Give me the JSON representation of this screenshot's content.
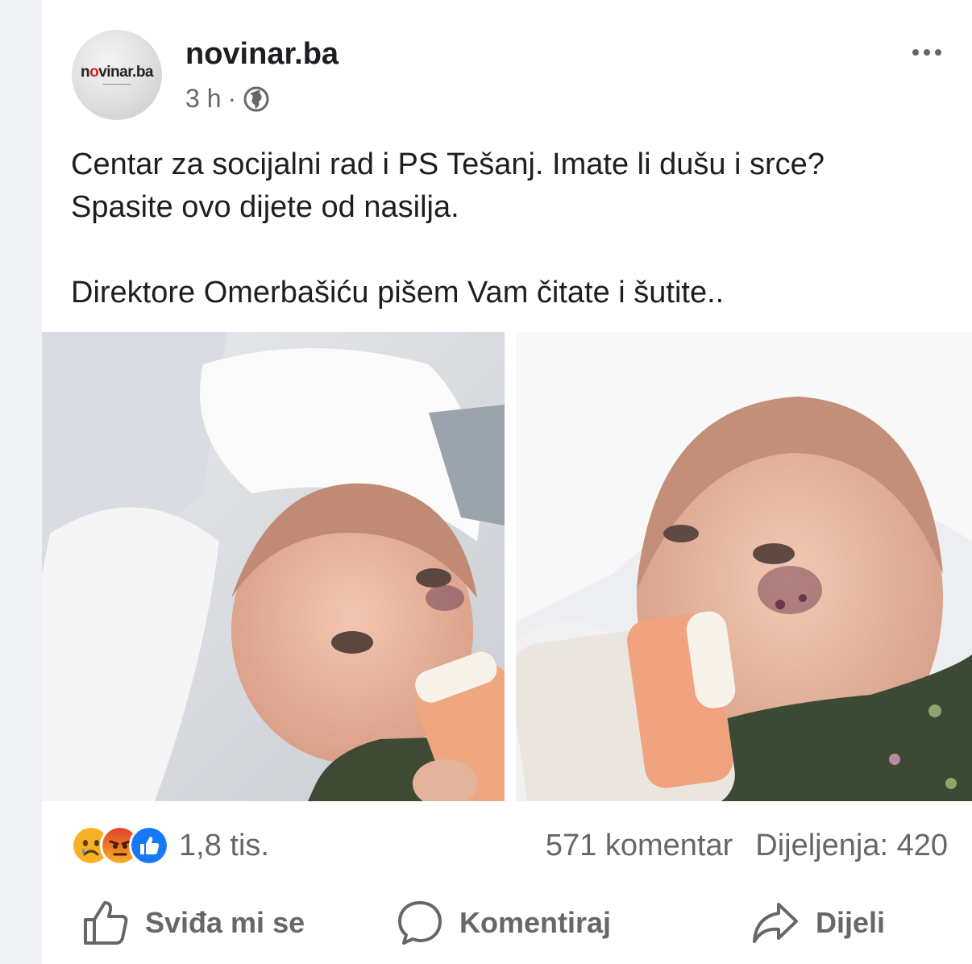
{
  "post": {
    "page_name": "novinar.ba",
    "time": "3 h",
    "separator": "·",
    "avatar": {
      "logo_prefix": "n",
      "logo_o": "o",
      "logo_rest": "vinar.ba"
    },
    "text_paragraphs": [
      "Centar za socijalni rad i PS Tešanj. Imate  li dušu i srce? Spasite ovo dijete od nasilja.",
      "Direktore Omerbašiću pišem Vam čitate i šutite.."
    ]
  },
  "icons": {
    "audience": "globe-icon",
    "menu": "more-options-icon",
    "reactions": [
      "sad-reaction-icon",
      "angry-reaction-icon",
      "like-reaction-icon"
    ],
    "like": "thumbs-up-icon",
    "comment": "comment-bubble-icon",
    "share": "share-arrow-icon"
  },
  "stats": {
    "reactions_count": "1,8 tis.",
    "comments": "571 komentar",
    "shares": "Dijeljenja: 420"
  },
  "actions": {
    "like_label": "Sviđa mi se",
    "comment_label": "Komentiraj",
    "share_label": "Dijeli"
  },
  "colors": {
    "like_blue": "#1877f2",
    "angry_red": "#e9710f",
    "sad_yellow": "#f7b125",
    "secondary_text": "#65676b"
  }
}
